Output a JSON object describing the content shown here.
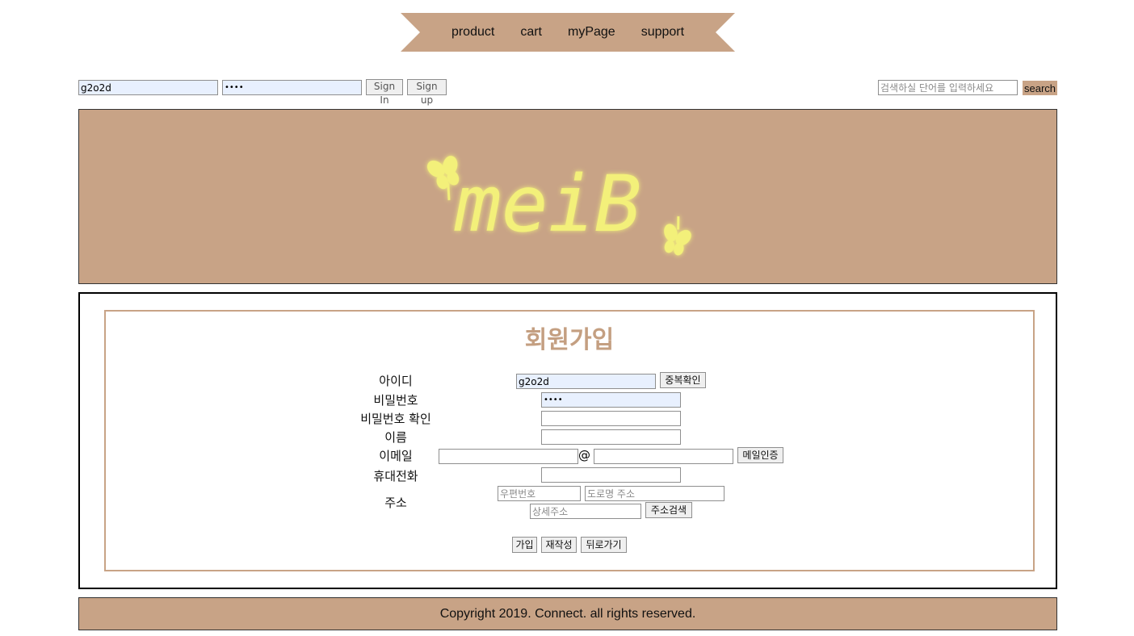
{
  "nav": {
    "items": [
      "product",
      "cart",
      "myPage",
      "support"
    ],
    "ribbon_color": "#c8a386"
  },
  "auth": {
    "id_value": "g2o2d",
    "password_value": "••••",
    "signin_label": "Sign In",
    "signup_label": "Sign up"
  },
  "search": {
    "placeholder": "검색하실 단어를 입력하세요",
    "button_label": "search"
  },
  "banner": {
    "logo_text": "meiB",
    "background": "#c8a386",
    "logo_color": "#f3f07a",
    "decoration_icon": "butterfly-icon"
  },
  "form": {
    "title": "회원가입",
    "id_label": "아이디",
    "id_value": "g2o2d",
    "dup_check_label": "중복확인",
    "password_label": "비밀번호",
    "password_value": "••••",
    "password_confirm_label": "비밀번호 확인",
    "name_label": "이름",
    "email_label": "이메일",
    "email_at": "@",
    "email_verify_label": "메일인증",
    "phone_label": "휴대전화",
    "address_label": "주소",
    "zipcode_placeholder": "우편번호",
    "road_address_placeholder": "도로명 주소",
    "detail_address_placeholder": "상세주소",
    "address_search_label": "주소검색",
    "join_label": "가입",
    "reset_label": "재작성",
    "back_label": "뒤로가기",
    "accent_color": "#c49f81"
  },
  "footer": {
    "text": "Copyright 2019. Connect. all rights reserved."
  }
}
